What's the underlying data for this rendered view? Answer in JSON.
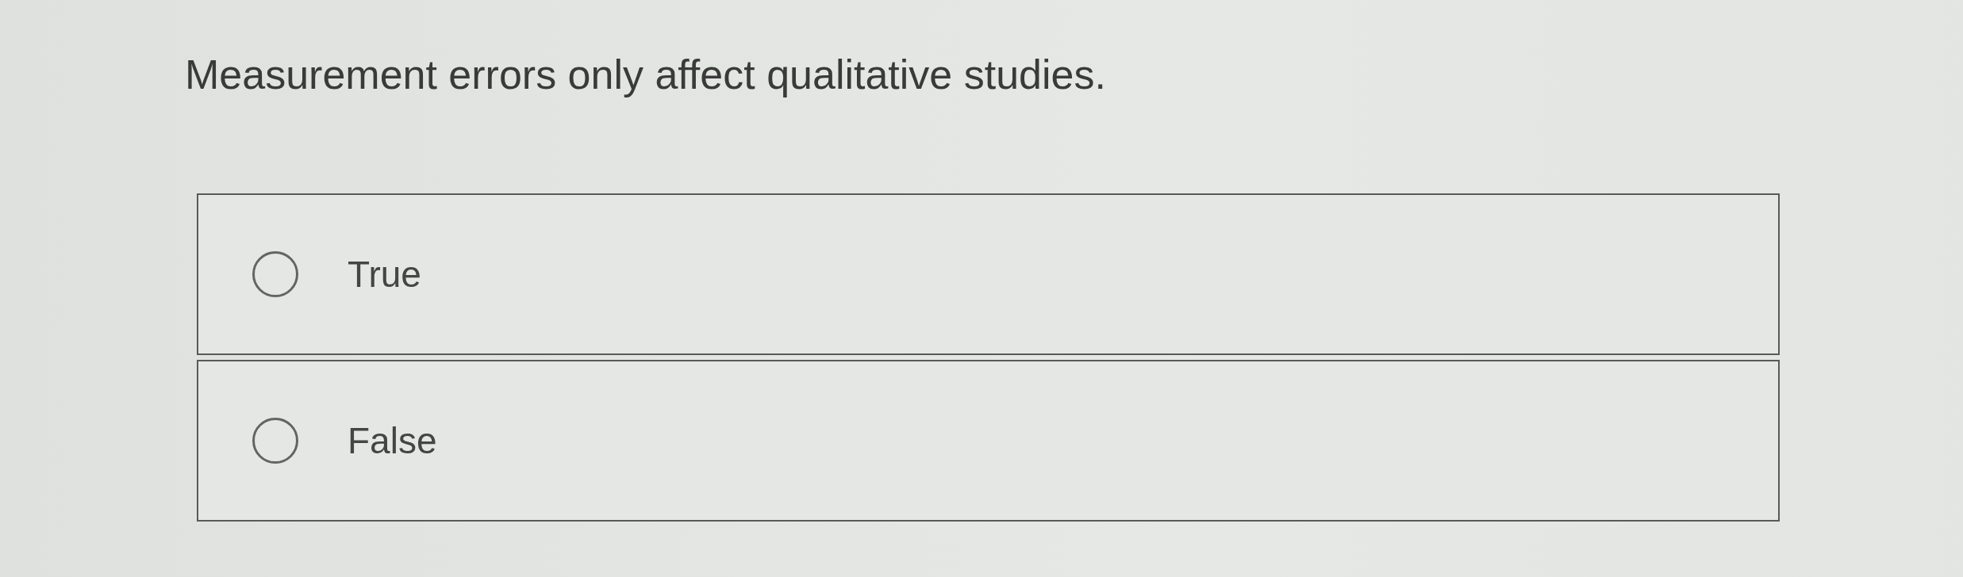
{
  "question": {
    "text": "Measurement errors only affect qualitative studies."
  },
  "options": [
    {
      "label": "True",
      "selected": false
    },
    {
      "label": "False",
      "selected": false
    }
  ]
}
